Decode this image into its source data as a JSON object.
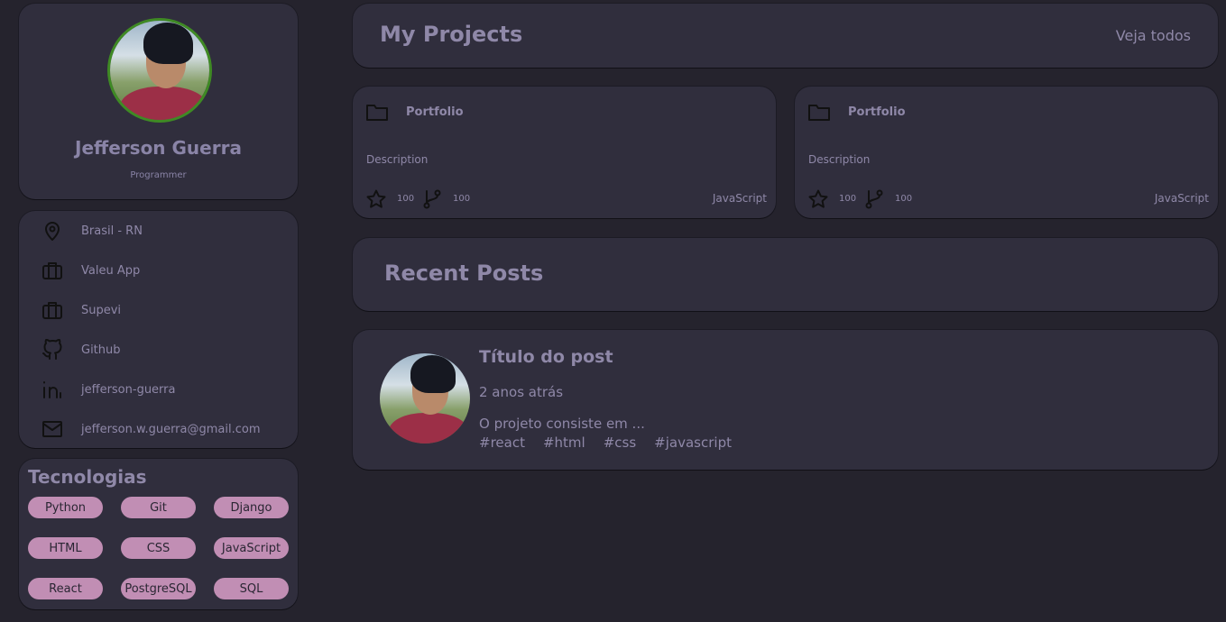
{
  "profile": {
    "name": "Jefferson Guerra",
    "role": "Programmer"
  },
  "info": [
    {
      "icon": "location-pin-icon",
      "label": "Brasil - RN"
    },
    {
      "icon": "briefcase-icon",
      "label": "Valeu App"
    },
    {
      "icon": "briefcase-icon",
      "label": "Supevi"
    },
    {
      "icon": "github-icon",
      "label": "Github"
    },
    {
      "icon": "linkedin-icon",
      "label": "jefferson-guerra"
    },
    {
      "icon": "mail-icon",
      "label": "jefferson.w.guerra@gmail.com"
    }
  ],
  "tech": {
    "title": "Tecnologias",
    "items": [
      "Python",
      "Git",
      "Django",
      "HTML",
      "CSS",
      "JavaScript",
      "React",
      "PostgreSQL",
      "SQL"
    ]
  },
  "projects": {
    "title": "My Projects",
    "see_all": "Veja todos",
    "items": [
      {
        "name": "Portfolio",
        "description": "Description",
        "stars": "100",
        "forks": "100",
        "language": "JavaScript"
      },
      {
        "name": "Portfolio",
        "description": "Description",
        "stars": "100",
        "forks": "100",
        "language": "JavaScript"
      }
    ]
  },
  "posts": {
    "title": "Recent Posts",
    "items": [
      {
        "title": "Título do post",
        "date": "2 anos atrás",
        "excerpt": "O projeto consiste em ...",
        "tags": [
          "#react",
          "#html",
          "#css",
          "#javascript"
        ]
      }
    ]
  },
  "colors": {
    "background": "#25232d",
    "card": "#302e3d",
    "text": "#8f88a8",
    "chip": "#c18eb4",
    "avatar_ring": "#3f8a24"
  }
}
